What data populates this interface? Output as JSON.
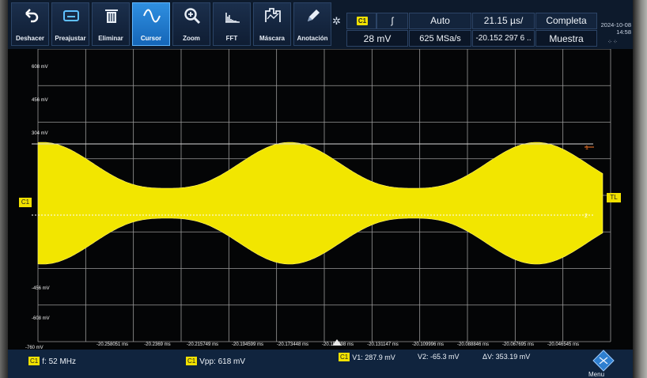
{
  "toolbar": {
    "tools": [
      {
        "label": "Deshacer",
        "icon": "undo-icon"
      },
      {
        "label": "Preajustar",
        "icon": "preset-icon"
      },
      {
        "label": "Eliminar",
        "icon": "trash-icon"
      },
      {
        "label": "Cursor",
        "icon": "cursor-wave-icon",
        "active": true
      },
      {
        "label": "Zoom",
        "icon": "zoom-icon"
      },
      {
        "label": "FFT",
        "icon": "fft-icon"
      },
      {
        "label": "Máscara",
        "icon": "mask-icon"
      },
      {
        "label": "Anotación",
        "icon": "pencil-icon"
      }
    ],
    "channel": {
      "badge": "C1",
      "scale": "28 mV",
      "trigger_edge": "ʃ"
    },
    "trigger_mode": "Auto",
    "sample_rate": "625 MSa/s",
    "time_scale": "21.15 µs/",
    "time_offset": "-20.152 297 6 ..",
    "acq_state": "Completa",
    "acq_mode": "Muestra",
    "date": "2024-10-08",
    "time": "14:58"
  },
  "plot": {
    "y_labels": [
      "608 mV",
      "456 mV",
      "304 mV",
      "-456 mV",
      "-608 mV",
      "-760 mV"
    ],
    "x_labels": [
      "-20.258051 ms",
      "-20.2369 ms",
      "-20.215749 ms",
      "-20.194599 ms",
      "-20.173448 ms",
      "-20.152298 ms",
      "-20.131147 ms",
      "-20.109996 ms",
      "-20.088846 ms",
      "-20.067695 ms",
      "-20.046545 ms"
    ],
    "channel_marker": "C1",
    "trigger_level_marker": "TL",
    "cursor1_label": "1",
    "cursor2_label": "2",
    "trace_color": "#f2e600"
  },
  "status": {
    "freq_badge": "C1",
    "freq": "f: 52 MHz",
    "vpp_badge": "C1",
    "vpp": "Vpp: 618 mV",
    "cursor_badge": "C1",
    "v1": "V1: 287.9 mV",
    "v2": "V2: -65.3 mV",
    "dv": "ΔV: 353.19 mV",
    "menu_label": "Menu"
  },
  "colors": {
    "accent": "#1f7fd6",
    "channel1": "#f1e100",
    "panel": "#10243e"
  }
}
